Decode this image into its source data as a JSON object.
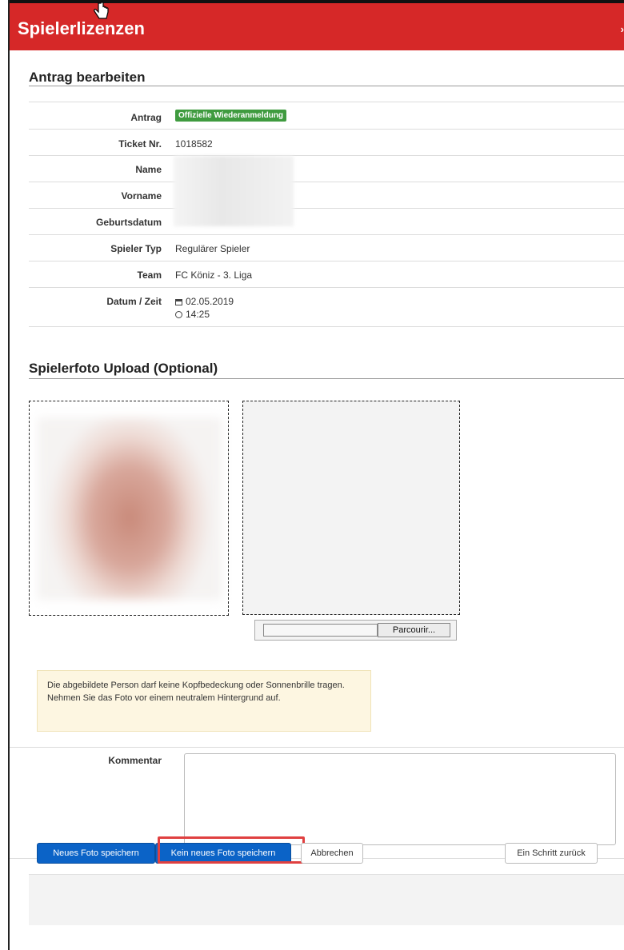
{
  "app": {
    "title": "Spielerlizenzen"
  },
  "section_edit": {
    "title": "Antrag bearbeiten"
  },
  "details": [
    {
      "label": "Antrag",
      "badge": "Offizielle Wiederanmeldung"
    },
    {
      "label": "Ticket Nr.",
      "value": "1018582"
    },
    {
      "label": "Name",
      "value": ""
    },
    {
      "label": "Vorname",
      "value": ""
    },
    {
      "label": "Geburtsdatum",
      "value": ""
    },
    {
      "label": "Spieler Typ",
      "value": "Regulärer Spieler"
    },
    {
      "label": "Team",
      "value": "FC Köniz - 3. Liga"
    },
    {
      "label": "Datum / Zeit",
      "date": "02.05.2019",
      "time": "14:25"
    }
  ],
  "section_photo": {
    "title": "Spielerfoto Upload (Optional)"
  },
  "upload": {
    "browse_label": "Parcourir..."
  },
  "notice": {
    "text": "Die abgebildete Person darf keine Kopfbedeckung oder Sonnenbrille tragen. Nehmen Sie das Foto vor einem neutralem Hintergrund auf."
  },
  "comment": {
    "label": "Kommentar",
    "value": ""
  },
  "buttons": {
    "save_new_photo": "Neues Foto speichern",
    "save_no_photo": "Kein neues Foto speichern",
    "cancel": "Abbrechen",
    "back": "Ein Schritt zurück"
  },
  "colors": {
    "header": "#d62828",
    "primary": "#0b63c7",
    "badge": "#3f9b3f",
    "highlight": "#e04040"
  }
}
